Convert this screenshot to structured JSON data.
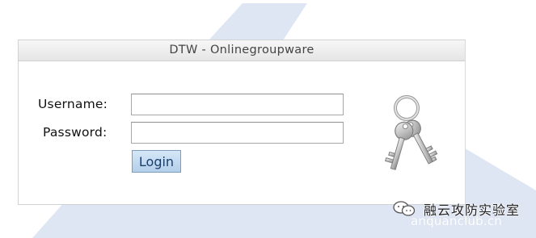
{
  "window": {
    "title": "DTW - Onlinegroupware"
  },
  "form": {
    "username_label": "Username:",
    "password_label": "Password:",
    "username_value": "",
    "password_value": "",
    "login_label": "Login"
  },
  "icons": {
    "keys": "keys-icon"
  },
  "watermark": {
    "title": "融云攻防实验室",
    "url": "anquanclub.cn"
  },
  "colors": {
    "background_shape": "#dfe6f3",
    "button_fill": "#c4dbf2",
    "button_border": "#7f9db9",
    "header_fill": "#ebebeb"
  }
}
